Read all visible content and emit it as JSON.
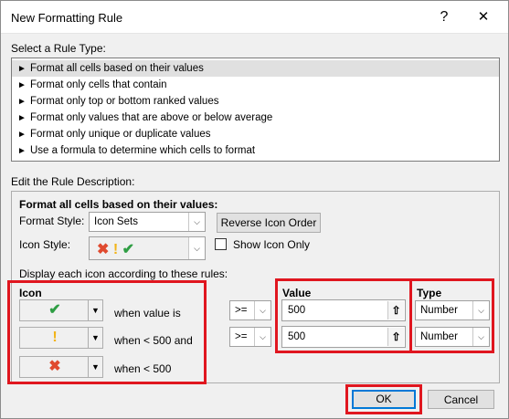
{
  "window": {
    "title": "New Formatting Rule",
    "help_label": "?",
    "close_label": "✕"
  },
  "rule_type": {
    "label": "Select a Rule Type:",
    "items": [
      {
        "label": "Format all cells based on their values",
        "selected": true
      },
      {
        "label": "Format only cells that contain",
        "selected": false
      },
      {
        "label": "Format only top or bottom ranked values",
        "selected": false
      },
      {
        "label": "Format only values that are above or below average",
        "selected": false
      },
      {
        "label": "Format only unique or duplicate values",
        "selected": false
      },
      {
        "label": "Use a formula to determine which cells to format",
        "selected": false
      }
    ]
  },
  "description": {
    "label": "Edit the Rule Description:",
    "heading": "Format all cells based on their values:",
    "format_style_label": "Format Style:",
    "format_style_value": "Icon Sets",
    "reverse_button": "Reverse Icon Order",
    "icon_style_label": "Icon Style:",
    "show_icon_only_label": "Show Icon Only",
    "show_icon_only_checked": false,
    "rules_label": "Display each icon according to these rules:",
    "columns": {
      "icon": "Icon",
      "value": "Value",
      "type": "Type"
    },
    "rules": [
      {
        "icon": "green-check",
        "text": "when value is",
        "operator": ">=",
        "value": "500",
        "type": "Number"
      },
      {
        "icon": "yellow-exclamation",
        "text": "when < 500 and",
        "operator": ">=",
        "value": "500",
        "type": "Number"
      },
      {
        "icon": "red-x",
        "text": "when < 500"
      }
    ]
  },
  "footer": {
    "ok_label": "OK",
    "cancel_label": "Cancel"
  },
  "colors": {
    "highlight": "#e0161f",
    "green": "#2f9e44",
    "yellow": "#f2b418",
    "red": "#e04a2f",
    "ok_border": "#0078d7"
  }
}
